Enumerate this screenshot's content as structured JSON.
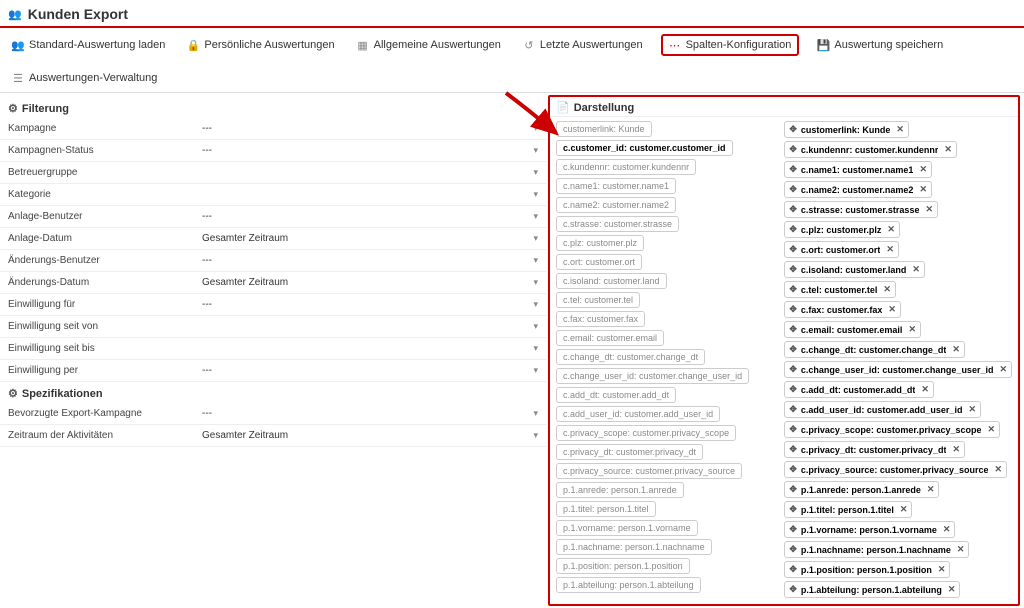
{
  "header": {
    "title": "Kunden Export"
  },
  "toolbar": {
    "load_standard": "Standard-Auswertung laden",
    "personal": "Persönliche Auswertungen",
    "general": "Allgemeine Auswertungen",
    "recent": "Letzte Auswertungen",
    "columns": "Spalten-Konfiguration",
    "save": "Auswertung speichern",
    "manage": "Auswertungen-Verwaltung"
  },
  "sections": {
    "filter_title": "Filterung",
    "spec_title": "Spezifikationen"
  },
  "filters": [
    {
      "label": "Kampagne",
      "value": "---"
    },
    {
      "label": "Kampagnen-Status",
      "value": "---"
    },
    {
      "label": "Betreuergruppe",
      "value": ""
    },
    {
      "label": "Kategorie",
      "value": ""
    },
    {
      "label": "Anlage-Benutzer",
      "value": "---"
    },
    {
      "label": "Anlage-Datum",
      "value": "Gesamter Zeitraum"
    },
    {
      "label": "Änderungs-Benutzer",
      "value": "---"
    },
    {
      "label": "Änderungs-Datum",
      "value": "Gesamter Zeitraum"
    },
    {
      "label": "Einwilligung für",
      "value": "---"
    },
    {
      "label": "Einwilligung seit von",
      "value": ""
    },
    {
      "label": "Einwilligung seit bis",
      "value": ""
    },
    {
      "label": "Einwilligung per",
      "value": "---"
    }
  ],
  "specs": [
    {
      "label": "Bevorzugte Export-Kampagne",
      "value": "---"
    },
    {
      "label": "Zeitraum der Aktivitäten",
      "value": "Gesamter Zeitraum"
    }
  ],
  "darstellung": {
    "title": "Darstellung",
    "available": [
      {
        "label": "customerlink: Kunde",
        "active": false
      },
      {
        "label": "c.customer_id: customer.customer_id",
        "active": true
      },
      {
        "label": "c.kundennr: customer.kundennr",
        "active": false
      },
      {
        "label": "c.name1: customer.name1",
        "active": false
      },
      {
        "label": "c.name2: customer.name2",
        "active": false
      },
      {
        "label": "c.strasse: customer.strasse",
        "active": false
      },
      {
        "label": "c.plz: customer.plz",
        "active": false
      },
      {
        "label": "c.ort: customer.ort",
        "active": false
      },
      {
        "label": "c.isoland: customer.land",
        "active": false
      },
      {
        "label": "c.tel: customer.tel",
        "active": false
      },
      {
        "label": "c.fax: customer.fax",
        "active": false
      },
      {
        "label": "c.email: customer.email",
        "active": false
      },
      {
        "label": "c.change_dt: customer.change_dt",
        "active": false
      },
      {
        "label": "c.change_user_id: customer.change_user_id",
        "active": false
      },
      {
        "label": "c.add_dt: customer.add_dt",
        "active": false
      },
      {
        "label": "c.add_user_id: customer.add_user_id",
        "active": false
      },
      {
        "label": "c.privacy_scope: customer.privacy_scope",
        "active": false
      },
      {
        "label": "c.privacy_dt: customer.privacy_dt",
        "active": false
      },
      {
        "label": "c.privacy_source: customer.privacy_source",
        "active": false
      },
      {
        "label": "p.1.anrede: person.1.anrede",
        "active": false
      },
      {
        "label": "p.1.titel: person.1.titel",
        "active": false
      },
      {
        "label": "p.1.vorname: person.1.vorname",
        "active": false
      },
      {
        "label": "p.1.nachname: person.1.nachname",
        "active": false
      },
      {
        "label": "p.1.position: person.1.position",
        "active": false
      },
      {
        "label": "p.1.abteilung: person.1.abteilung",
        "active": false
      }
    ],
    "selected": [
      "customerlink: Kunde",
      "c.kundennr: customer.kundennr",
      "c.name1: customer.name1",
      "c.name2: customer.name2",
      "c.strasse: customer.strasse",
      "c.plz: customer.plz",
      "c.ort: customer.ort",
      "c.isoland: customer.land",
      "c.tel: customer.tel",
      "c.fax: customer.fax",
      "c.email: customer.email",
      "c.change_dt: customer.change_dt",
      "c.change_user_id: customer.change_user_id",
      "c.add_dt: customer.add_dt",
      "c.add_user_id: customer.add_user_id",
      "c.privacy_scope: customer.privacy_scope",
      "c.privacy_dt: customer.privacy_dt",
      "c.privacy_source: customer.privacy_source",
      "p.1.anrede: person.1.anrede",
      "p.1.titel: person.1.titel",
      "p.1.vorname: person.1.vorname",
      "p.1.nachname: person.1.nachname",
      "p.1.position: person.1.position",
      "p.1.abteilung: person.1.abteilung"
    ]
  }
}
